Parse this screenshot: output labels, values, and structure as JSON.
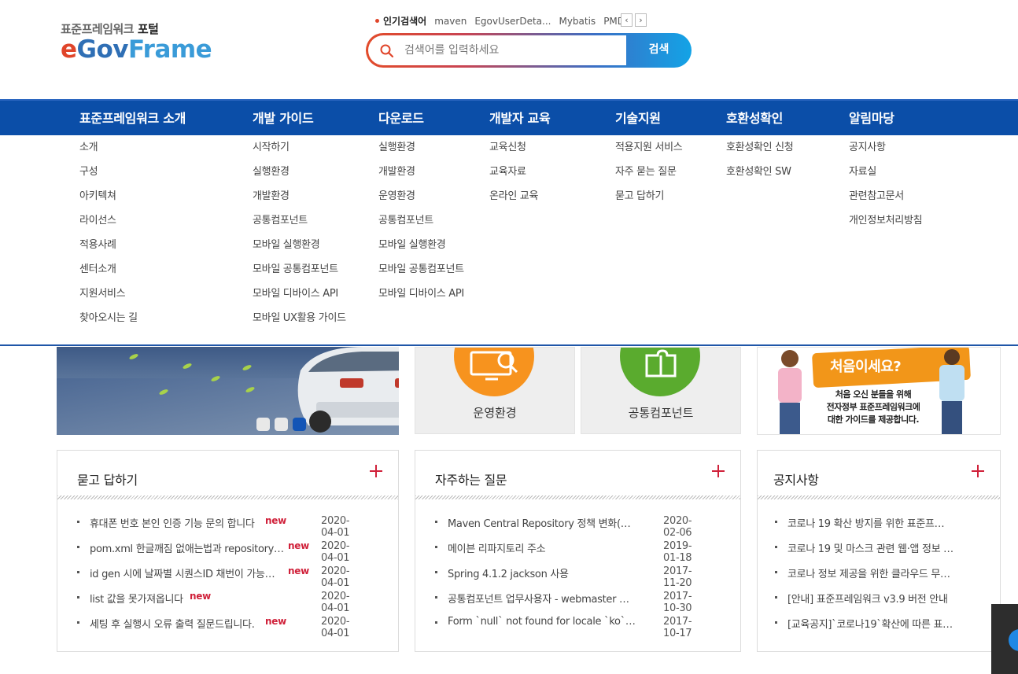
{
  "logo": {
    "sub_prefix": "표준프레임워크",
    "sub_suffix": "포털",
    "main_e": "e",
    "main_gov": "Gov",
    "main_frame": "Frame"
  },
  "popular": {
    "title": "인기검색어",
    "keywords": [
      "maven",
      "EgovUserDeta...",
      "Mybatis",
      "PMD"
    ],
    "prev": "‹",
    "next": "›"
  },
  "search": {
    "placeholder": "검색어를 입력하세요",
    "button": "검색"
  },
  "nav": [
    {
      "label": "표준프레임워크 소개",
      "items": [
        "소개",
        "구성",
        "아키텍쳐",
        "라이선스",
        "적용사례",
        "센터소개",
        "지원서비스",
        "찾아오시는 길"
      ]
    },
    {
      "label": "개발 가이드",
      "items": [
        "시작하기",
        "실행환경",
        "개발환경",
        "공통컴포넌트",
        "모바일 실행환경",
        "모바일 공통컴포넌트",
        "모바일 디바이스 API",
        "모바일 UX활용 가이드"
      ]
    },
    {
      "label": "다운로드",
      "items": [
        "실행환경",
        "개발환경",
        "운영환경",
        "공통컴포넌트",
        "모바일 실행환경",
        "모바일 공통컴포넌트",
        "모바일 디바이스 API"
      ]
    },
    {
      "label": "개발자 교육",
      "items": [
        "교육신청",
        "교육자료",
        "온라인 교육"
      ]
    },
    {
      "label": "기술지원",
      "items": [
        "적용지원 서비스",
        "자주 묻는 질문",
        "묻고 답하기"
      ]
    },
    {
      "label": "호환성확인",
      "items": [
        "호환성확인 신청",
        "호환성확인 SW"
      ]
    },
    {
      "label": "알림마당",
      "items": [
        "공지사항",
        "자료실",
        "관련참고문서",
        "개인정보처리방침"
      ]
    }
  ],
  "cards": [
    {
      "label": "운영환경",
      "color": "#f7931e"
    },
    {
      "label": "공통컴포넌트",
      "color": "#5aab2e"
    }
  ],
  "welcome": {
    "title": "처음이세요?",
    "text": [
      "처음 오신 분들을 위해",
      "전자정부 표준프레임워크에",
      "대한 가이드를 제공합니다."
    ]
  },
  "boards": [
    {
      "title": "묻고 답하기",
      "rows": [
        {
          "text": "휴대폰 번호 본인 인증 기능 문의 합니다",
          "new": "new",
          "date": "2020-04-01"
        },
        {
          "text": "pom.xml 한글깨짐 없애는법과 repository…",
          "new": "new",
          "date": "2020-04-01"
        },
        {
          "text": "id gen 시에 날짜별 시퀀스ID 채번이 가능…",
          "new": "new",
          "date": "2020-04-01"
        },
        {
          "text": "list 값을 못가져옵니다",
          "new": "new",
          "date": "2020-04-01"
        },
        {
          "text": "세팅 후 실행시 오류 출력 질문드립니다.",
          "new": "new",
          "date": "2020-04-01"
        }
      ]
    },
    {
      "title": "자주하는 질문",
      "rows": [
        {
          "text": "Maven Central Repository 정책 변화(2…",
          "new": "",
          "date": "2020-02-06"
        },
        {
          "text": "메이븐 리파지토리 주소",
          "new": "",
          "date": "2019-01-18"
        },
        {
          "text": "Spring 4.1.2  jackson 사용",
          "new": "",
          "date": "2017-11-20"
        },
        {
          "text": "공통컴포넌트 업무사용자 - webmaster …",
          "new": "",
          "date": "2017-10-30"
        },
        {
          "text": "Form `null` not found for locale `ko` …",
          "new": "",
          "date": "2017-10-17"
        }
      ]
    },
    {
      "title": "공지사항",
      "rows": [
        {
          "text": "코로나 19 확산 방지를 위한 표준프…",
          "new": "",
          "date": ""
        },
        {
          "text": "코로나 19 및 마스크 관련 웹·앱 정보 …",
          "new": "",
          "date": ""
        },
        {
          "text": "코로나 정보 제공을 위한 클라우드 무…",
          "new": "",
          "date": ""
        },
        {
          "text": "[안내] 표준프레임워크 v3.9 버전 안내",
          "new": "",
          "date": ""
        },
        {
          "text": "[교육공지]`코로나19`확산에 따른 표…",
          "new": "",
          "date": ""
        }
      ]
    }
  ]
}
